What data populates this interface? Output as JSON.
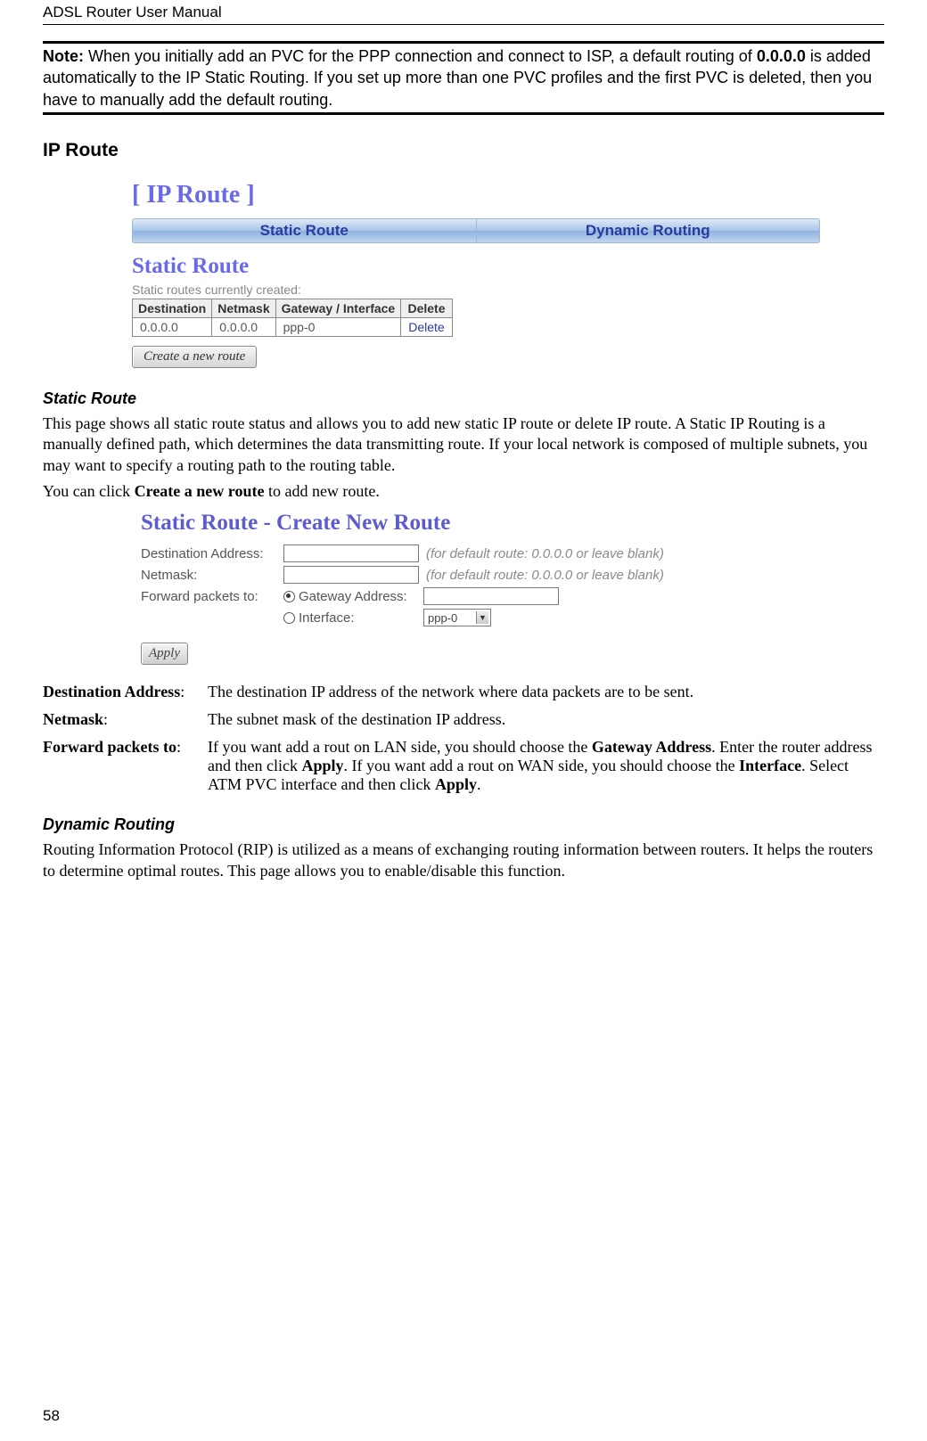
{
  "header": "ADSL Router User Manual",
  "note": {
    "label": "Note:",
    "pre": " When you initially add an PVC for the PPP connection and connect to ISP, a default routing of ",
    "ip": "0.0.0.0",
    "post": " is added automatically to the IP Static Routing. If you set up more than one PVC profiles and the first PVC is deleted, then you have to manually add the default routing."
  },
  "section_title": "IP Route",
  "shot1": {
    "title": "[ IP Route ]",
    "tab_left": "Static Route",
    "tab_right": "Dynamic Routing",
    "heading": "Static Route",
    "list_label": "Static routes currently created:",
    "th": {
      "dest": "Destination",
      "mask": "Netmask",
      "gw": "Gateway / Interface",
      "del": "Delete"
    },
    "row": {
      "dest": "0.0.0.0",
      "mask": "0.0.0.0",
      "gw": "ppp-0",
      "del": "Delete"
    },
    "create_btn": "Create a new route"
  },
  "sr": {
    "heading": "Static Route",
    "p1": "This page shows all static route status and allows you to add new static IP route or delete IP route. A Static IP Routing is a manually defined path, which determines the data transmitting route. If your local network is composed of multiple subnets, you may want to specify a routing path to the routing table.",
    "p2_pre": "You can click ",
    "p2_strong": "Create a new route",
    "p2_post": " to add new route."
  },
  "shot2": {
    "title": "Static Route - Create New Route",
    "dest_lbl": "Destination Address:",
    "mask_lbl": "Netmask:",
    "fwd_lbl": "Forward packets to:",
    "gw_lbl": "Gateway Address:",
    "if_lbl": "Interface:",
    "hint": "(for default route: 0.0.0.0 or leave blank)",
    "if_value": "ppp-0",
    "apply": "Apply"
  },
  "defs": {
    "d1": {
      "term": "Destination Address",
      "desc": "The destination IP address of the network where data packets are to be sent."
    },
    "d2": {
      "term": "Netmask",
      "desc": "The subnet mask of the destination IP address."
    },
    "d3": {
      "term": "Forward packets to",
      "pre": "If you want add a rout on LAN side, you should choose the ",
      "s1": "Gateway Address",
      "mid1": ". Enter the router address and then click ",
      "s2": "Apply",
      "mid2": ". If you want add a rout on WAN side, you should choose the ",
      "s3": "Interface",
      "mid3": ". Select ATM PVC interface and then click ",
      "s4": "Apply",
      "post": "."
    }
  },
  "dr": {
    "heading": "Dynamic Routing",
    "p1": "Routing Information Protocol (RIP) is utilized as a means of exchanging routing information between routers. It helps the routers to determine optimal routes. This page allows you to enable/disable this function."
  },
  "pagenum": "58"
}
